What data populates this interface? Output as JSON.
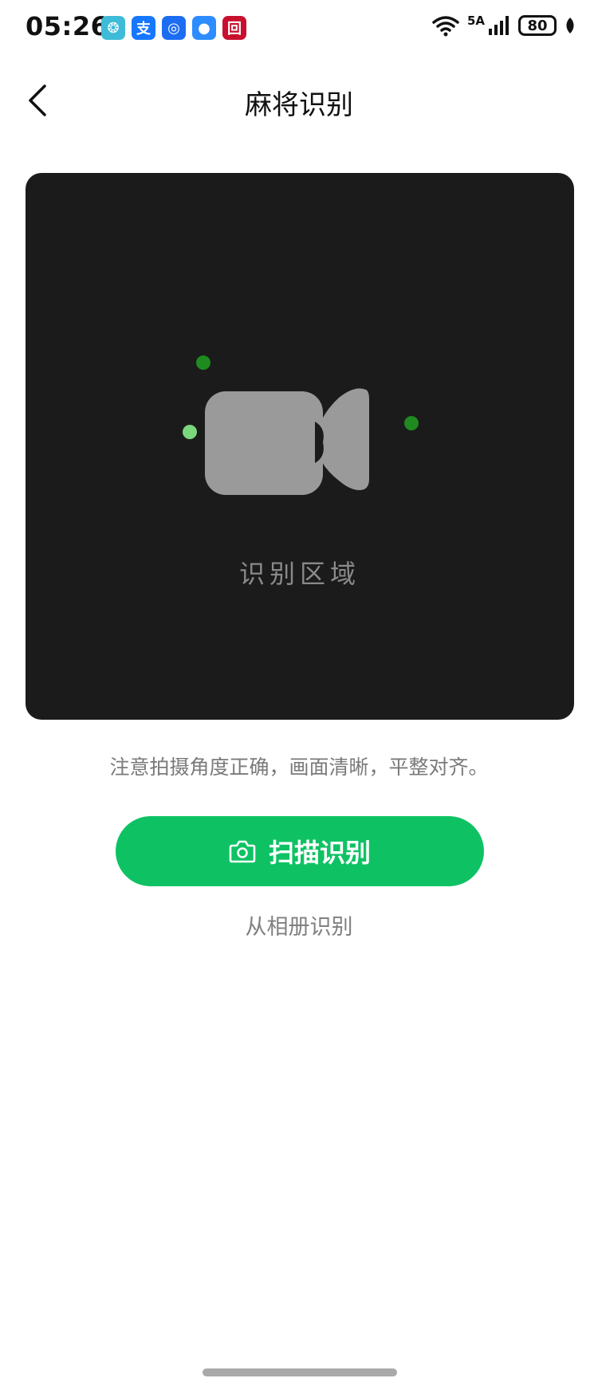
{
  "status_bar": {
    "time": "05:26",
    "network": "5A",
    "battery": "80",
    "apps": [
      {
        "name": "feather-app-icon",
        "glyph": "❂",
        "color": "#3dbbd8"
      },
      {
        "name": "alipay-app-icon",
        "glyph": "支",
        "color": "#1677ff"
      },
      {
        "name": "bulb-app-icon",
        "glyph": "◎",
        "color": "#1d6df2"
      },
      {
        "name": "message-app-icon",
        "glyph": "●",
        "color": "#2d8cff"
      },
      {
        "name": "bank-app-icon",
        "glyph": "回",
        "color": "#c8102e"
      }
    ]
  },
  "header": {
    "title": "麻将识别"
  },
  "scan_area": {
    "label": "识别区域"
  },
  "tip": "注意拍摄角度正确，画面清晰，平整对齐。",
  "scan_button": {
    "label": "扫描识别"
  },
  "album_link": "从相册识别",
  "colors": {
    "accent": "#0ec264",
    "scan_area_bg": "#1b1b1b"
  }
}
